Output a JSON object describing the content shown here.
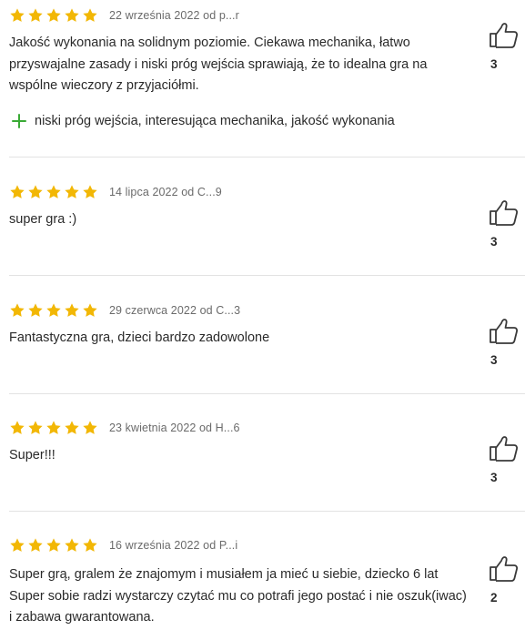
{
  "colors": {
    "star": "#f2b705",
    "plus": "#3aaa35",
    "divider": "#e2e2e2",
    "meta": "#6b6b6b"
  },
  "icons": {
    "star": "star-icon",
    "thumb": "thumbs-up-icon",
    "plus": "plus-icon"
  },
  "reviews": [
    {
      "rating": 5,
      "meta": "22 września 2022 od p...r",
      "text": "Jakość wykonania na solidnym poziomie. Ciekawa mechanika, łatwo przyswajalne zasady i niski próg wejścia sprawiają, że to idealna gra na wspólne wieczory z przyjaciółmi.",
      "pros": "niski próg wejścia, interesująca mechanika, jakość wykonania",
      "likes": "3"
    },
    {
      "rating": 5,
      "meta": "14 lipca 2022 od C...9",
      "text": "super gra :)",
      "likes": "3"
    },
    {
      "rating": 5,
      "meta": "29 czerwca 2022 od C...3",
      "text": "Fantastyczna gra, dzieci bardzo zadowolone",
      "likes": "3"
    },
    {
      "rating": 5,
      "meta": "23 kwietnia 2022 od H...6",
      "text": "Super!!!",
      "likes": "3"
    },
    {
      "rating": 5,
      "meta": "16 września 2022 od P...i",
      "text": "Super grą, gralem że znajomym i musiałem ja mieć u siebie, dziecko 6 lat Super sobie radzi wystarczy czytać mu co potrafi jego postać i nie oszuk(iwac) i zabawa gwarantowana.",
      "likes": "2"
    }
  ]
}
